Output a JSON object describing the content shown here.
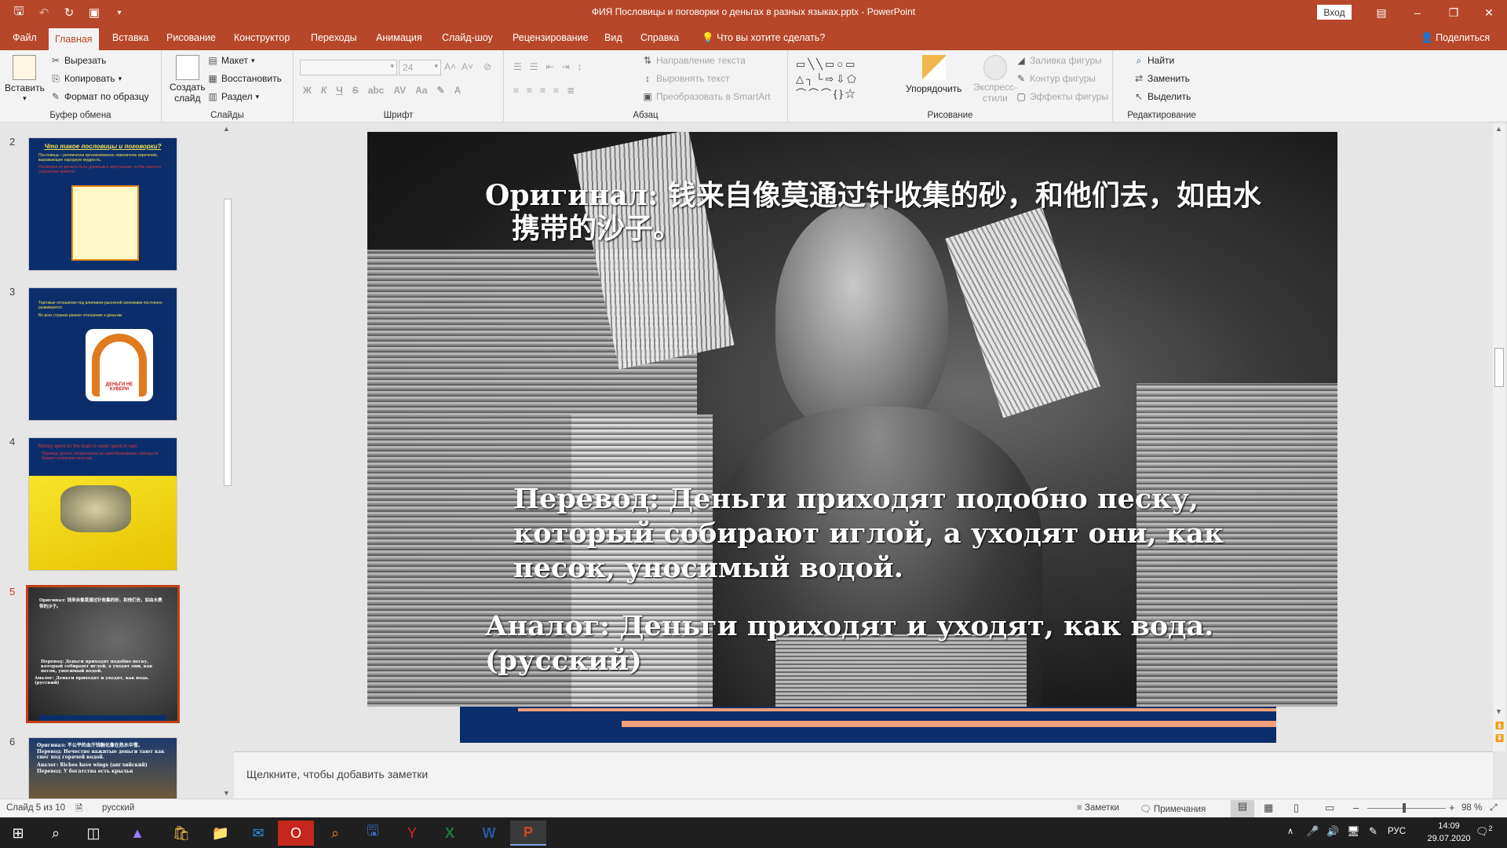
{
  "titlebar": {
    "title": "ФИЯ Пословицы и поговорки о деньгах в разных языках.pptx  -  PowerPoint",
    "signin": "Вход",
    "accent": "#b7472a"
  },
  "tabs": [
    "Файл",
    "Главная",
    "Вставка",
    "Рисование",
    "Конструктор",
    "Переходы",
    "Анимация",
    "Слайд-шоу",
    "Рецензирование",
    "Вид",
    "Справка"
  ],
  "tell_me": "Что вы хотите сделать?",
  "share": "Поделиться",
  "ribbon": {
    "clipboard": {
      "paste": "Вставить",
      "cut": "Вырезать",
      "copy": "Копировать",
      "format": "Формат по образцу",
      "label": "Буфер обмена"
    },
    "slides": {
      "new_slide_1": "Создать",
      "new_slide_2": "слайд",
      "layout": "Макет",
      "reset": "Восстановить",
      "section": "Раздел",
      "label": "Слайды"
    },
    "font": {
      "size": "24",
      "label": "Шрифт"
    },
    "paragraph": {
      "text_direction": "Направление текста",
      "align_text": "Выровнять текст",
      "smartart": "Преобразовать в SmartArt",
      "label": "Абзац"
    },
    "drawing": {
      "arrange": "Упорядочить",
      "quick_styles_1": "Экспресс-",
      "quick_styles_2": "стили",
      "fill": "Заливка фигуры",
      "outline": "Контур фигуры",
      "effects": "Эффекты фигуры",
      "label": "Рисование"
    },
    "editing": {
      "find": "Найти",
      "replace": "Заменить",
      "select": "Выделить",
      "label": "Редактирование"
    }
  },
  "thumbnails": [
    {
      "num": "2",
      "title": "Что такое пословицы и поговорки?",
      "line1": "Пословица – ритмически организованное лаконичное изречение, выражающее народную мудрость.",
      "line2": "Поговорка не должна быть длинным и запутанным, чтобы смысл и слушателю приятно."
    },
    {
      "num": "3",
      "line1": "Торговые отношения под влиянием рыночной экономики постоянно развиваются",
      "line2": "Во всех странах разное отношение к деньгам",
      "badge": "ДЕНЬГИ НЕ КУВЕРИ"
    },
    {
      "num": "4",
      "line1": "Money spent on the brain is never spent in vain",
      "line2": "Перевод: деньги, потраченные на самообразование, никогда не бывают потрачены впустую."
    },
    {
      "num": "5",
      "line1": "Оригинал: 钱来自像莫通过针收集的砂，和他们去，如由水携带的沙子。",
      "line2": "Перевод: Деньги приходят подобно песку, который собирают иглой, а уходят они, как песок, уносимый водой.",
      "line3": "Аналог: Деньги приходят и уходят, как вода. (русский)"
    },
    {
      "num": "6",
      "line1": "Оригинал: 不公平的血汗钱融化像在热水中雪。",
      "line2": "Перевод: Нечестно нажитые деньги тают как снег под горячей водой.",
      "line3": "Аналог: Riches have wings (английский)",
      "line4": "Перевод: У богатства есть крылья"
    }
  ],
  "slide": {
    "original": "Оригинал: 钱来自像莫通过针收集的砂，和他们去，如由水携带的沙子。",
    "translation": "Перевод: Деньги приходят подобно песку, который собирают иглой, а уходят они, как песок, уносимый водой.",
    "analog": "Аналог: Деньги приходят и уходят, как вода. (русский)"
  },
  "notes_placeholder": "Щелкните, чтобы добавить заметки",
  "status": {
    "slide_info": "Слайд 5 из 10",
    "language": "русский",
    "notes": "Заметки",
    "comments": "Примечания",
    "zoom": "98 %"
  },
  "taskbar": {
    "lang": "РУС",
    "time": "14:09",
    "date": "29.07.2020",
    "notif": "2"
  }
}
